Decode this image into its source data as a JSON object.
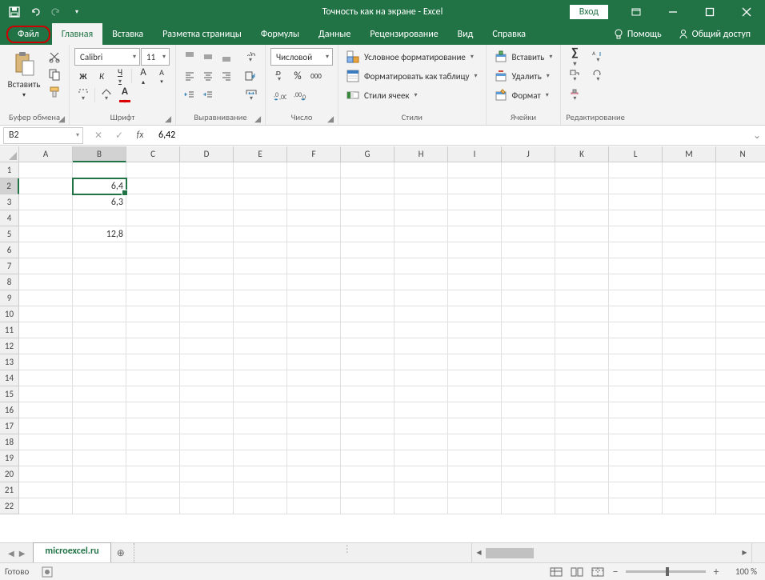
{
  "title": "Точность как на экране  -  Excel",
  "login": "Вход",
  "tabs": {
    "file": "Файл",
    "items": [
      "Главная",
      "Вставка",
      "Разметка страницы",
      "Формулы",
      "Данные",
      "Рецензирование",
      "Вид",
      "Справка"
    ],
    "tell": "Помощь",
    "share": "Общий доступ"
  },
  "ribbon": {
    "clipboard": {
      "paste": "Вставить",
      "label": "Буфер обмена"
    },
    "font": {
      "name": "Calibri",
      "size": "11",
      "bold": "Ж",
      "italic": "К",
      "underline": "Ч",
      "label": "Шрифт"
    },
    "alignment": {
      "label": "Выравнивание"
    },
    "number": {
      "format": "Числовой",
      "percent": "%",
      "thousands": "000",
      "label": "Число"
    },
    "styles": {
      "cond": "Условное форматирование",
      "table": "Форматировать как таблицу",
      "cell": "Стили ячеек",
      "label": "Стили"
    },
    "cells": {
      "insert": "Вставить",
      "delete": "Удалить",
      "format": "Формат",
      "label": "Ячейки"
    },
    "editing": {
      "label": "Редактирование"
    }
  },
  "namebox": "B2",
  "formula": "6,42",
  "columns": [
    "A",
    "B",
    "C",
    "D",
    "E",
    "F",
    "G",
    "H",
    "I",
    "J",
    "K",
    "L",
    "M",
    "N"
  ],
  "rowcount": 22,
  "selectedCell": {
    "row": 2,
    "col": "B"
  },
  "cells": {
    "B2": "6,4",
    "B3": "6,3",
    "B5": "12,8"
  },
  "sheet": "microexcel.ru",
  "status": "Готово",
  "zoom": "100 %"
}
